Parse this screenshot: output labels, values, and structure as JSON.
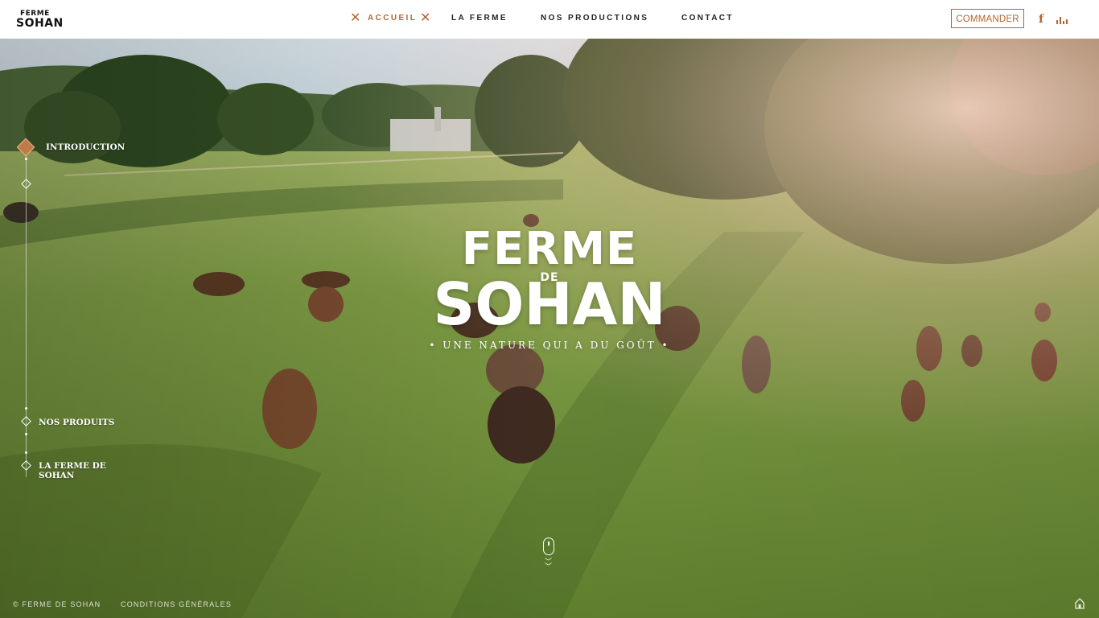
{
  "header": {
    "logo_line1": "FERME",
    "logo_line2": "SOHAN",
    "nav": [
      {
        "label": "ACCUEIL",
        "active": true
      },
      {
        "label": "LA FERME",
        "active": false
      },
      {
        "label": "NOS PRODUCTIONS",
        "active": false
      },
      {
        "label": "CONTACT",
        "active": false
      }
    ],
    "commander_label": "COMMANDER",
    "facebook_glyph": "f",
    "icons": [
      "close-icon",
      "facebook-icon",
      "equalizer-icon"
    ]
  },
  "sidenav": {
    "items": [
      {
        "label": "INTRODUCTION",
        "active": true
      },
      {
        "label": "",
        "active": false
      },
      {
        "label": "NOS PRODUITS",
        "active": false
      },
      {
        "label": "LA FERME DE SOHAN",
        "active": false
      }
    ]
  },
  "hero": {
    "title_top": "FERME",
    "title_de": "DE",
    "title_main": "SOHAN",
    "tagline": "• UNE NATURE QUI A DU GOÛT •"
  },
  "footer": {
    "copyright": "© FERME DE SOHAN",
    "conditions": "CONDITIONS GÉNÉRALES"
  },
  "colors": {
    "accent": "#b5652f",
    "header_bg": "#ffffff",
    "text_dark": "#222222"
  }
}
